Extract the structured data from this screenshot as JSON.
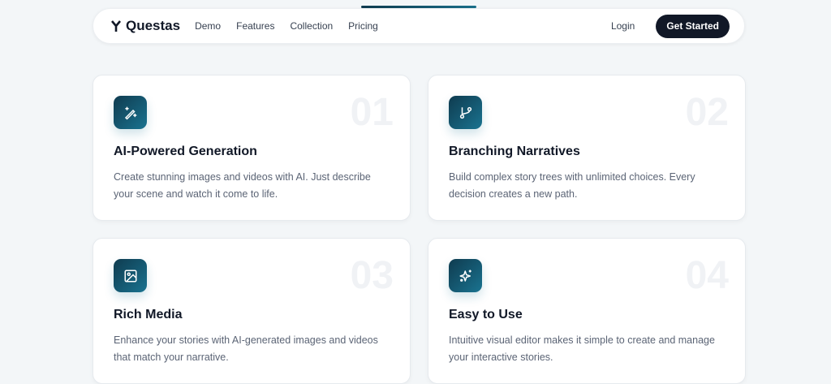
{
  "nav": {
    "brand": "Questas",
    "links": [
      "Demo",
      "Features",
      "Collection",
      "Pricing"
    ],
    "login": "Login",
    "cta": "Get Started"
  },
  "features": [
    {
      "num": "01",
      "icon": "magic-wand-icon",
      "title": "AI-Powered Generation",
      "desc": "Create stunning images and videos with AI. Just describe your scene and watch it come to life."
    },
    {
      "num": "02",
      "icon": "git-branch-icon",
      "title": "Branching Narratives",
      "desc": "Build complex story trees with unlimited choices. Every decision creates a new path."
    },
    {
      "num": "03",
      "icon": "image-icon",
      "title": "Rich Media",
      "desc": "Enhance your stories with AI-generated images and videos that match your narrative."
    },
    {
      "num": "04",
      "icon": "sparkles-icon",
      "title": "Easy to Use",
      "desc": "Intuitive visual editor makes it simple to create and manage your interactive stories."
    }
  ]
}
